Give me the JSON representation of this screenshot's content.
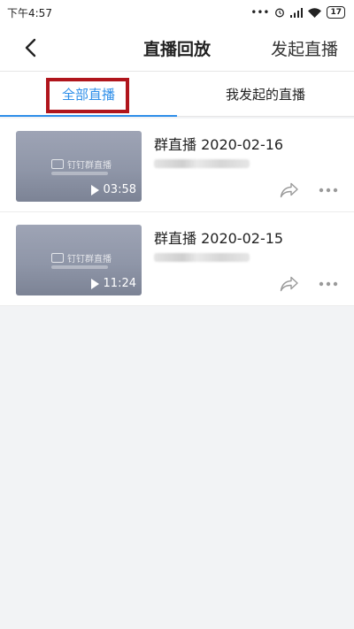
{
  "status": {
    "time": "下午4:57",
    "dots": "•••",
    "battery": "17"
  },
  "nav": {
    "title": "直播回放",
    "action": "发起直播"
  },
  "tabs": [
    {
      "label": "全部直播",
      "active": true
    },
    {
      "label": "我发起的直播",
      "active": false
    }
  ],
  "items": [
    {
      "title": "群直播 2020-02-16",
      "duration": "03:58",
      "watermark": "钉钉群直播"
    },
    {
      "title": "群直播 2020-02-15",
      "duration": "11:24",
      "watermark": "钉钉群直播"
    }
  ],
  "colors": {
    "accent": "#2d8ee9",
    "highlight": "#b0151c"
  }
}
